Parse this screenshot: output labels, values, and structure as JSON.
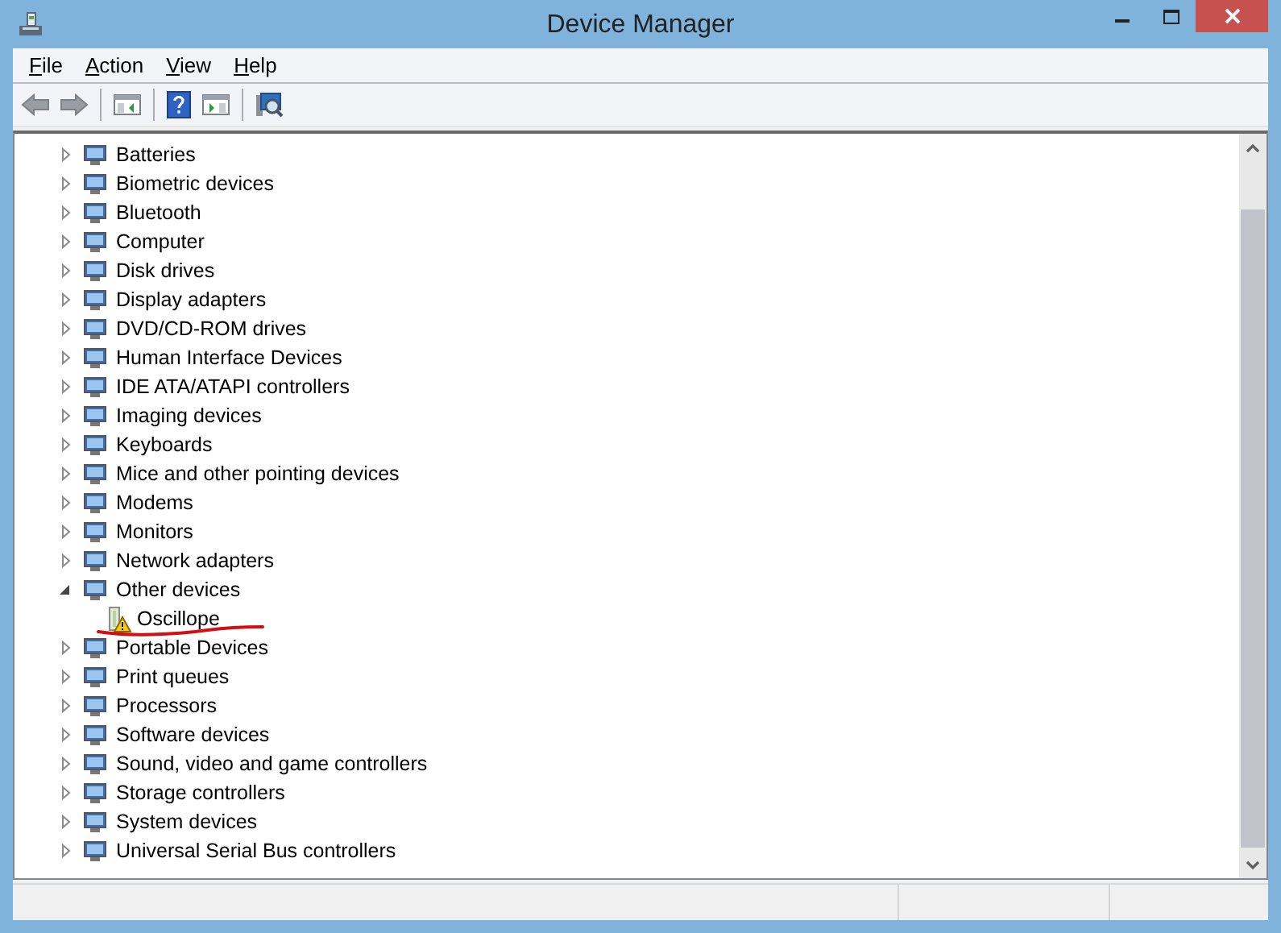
{
  "window": {
    "title": "Device Manager"
  },
  "menu": [
    {
      "label": "File"
    },
    {
      "label": "Action"
    },
    {
      "label": "View"
    },
    {
      "label": "Help"
    }
  ],
  "tree": [
    {
      "label": "Batteries",
      "expanded": false
    },
    {
      "label": "Biometric devices",
      "expanded": false
    },
    {
      "label": "Bluetooth",
      "expanded": false
    },
    {
      "label": "Computer",
      "expanded": false
    },
    {
      "label": "Disk drives",
      "expanded": false
    },
    {
      "label": "Display adapters",
      "expanded": false
    },
    {
      "label": "DVD/CD-ROM drives",
      "expanded": false
    },
    {
      "label": "Human Interface Devices",
      "expanded": false
    },
    {
      "label": "IDE ATA/ATAPI controllers",
      "expanded": false
    },
    {
      "label": "Imaging devices",
      "expanded": false
    },
    {
      "label": "Keyboards",
      "expanded": false
    },
    {
      "label": "Mice and other pointing devices",
      "expanded": false
    },
    {
      "label": "Modems",
      "expanded": false
    },
    {
      "label": "Monitors",
      "expanded": false
    },
    {
      "label": "Network adapters",
      "expanded": false
    },
    {
      "label": "Other devices",
      "expanded": true,
      "children": [
        {
          "label": "Oscillope",
          "warning": true
        }
      ]
    },
    {
      "label": "Portable Devices",
      "expanded": false
    },
    {
      "label": "Print queues",
      "expanded": false
    },
    {
      "label": "Processors",
      "expanded": false
    },
    {
      "label": "Software devices",
      "expanded": false
    },
    {
      "label": "Sound, video and game controllers",
      "expanded": false
    },
    {
      "label": "Storage controllers",
      "expanded": false
    },
    {
      "label": "System devices",
      "expanded": false
    },
    {
      "label": "Universal Serial Bus controllers",
      "expanded": false
    }
  ]
}
